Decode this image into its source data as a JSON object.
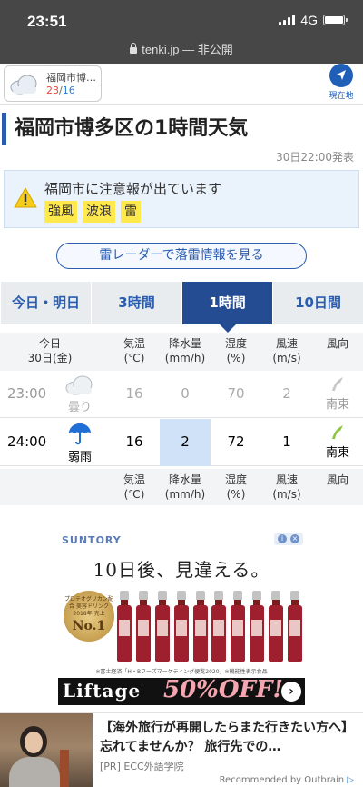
{
  "status_bar": {
    "time": "23:51",
    "network": "4G",
    "url": "tenki.jp — 非公開"
  },
  "header": {
    "location_name": "福岡市博…",
    "temp_high": "23",
    "temp_sep": "/",
    "temp_low": "16",
    "current_location_label": "現在地"
  },
  "page": {
    "title": "福岡市博多区の1時間天気",
    "issued": "30日22:00発表"
  },
  "alert": {
    "text": "福岡市に注意報が出ています",
    "tags": [
      "強風",
      "波浪",
      "雷"
    ]
  },
  "radar_button": "雷レーダーで落雷情報を見る",
  "tabs": [
    {
      "label": "今日・明日",
      "active": false
    },
    {
      "label": "3時間",
      "active": false
    },
    {
      "label": "1時間",
      "active": true
    },
    {
      "label": "10日間",
      "active": false
    }
  ],
  "table": {
    "date_line1": "今日",
    "date_line2": "30日(金)",
    "headers": [
      {
        "line1": "気温",
        "line2": "(℃)"
      },
      {
        "line1": "降水量",
        "line2": "(mm/h)"
      },
      {
        "line1": "湿度",
        "line2": "(%)"
      },
      {
        "line1": "風速",
        "line2": "(m/s)"
      },
      {
        "line1": "風向",
        "line2": ""
      }
    ],
    "rows": [
      {
        "time": "23:00",
        "weather": "曇り",
        "weather_icon": "cloud-icon",
        "temp": "16",
        "precip": "0",
        "humidity": "70",
        "wind_speed": "2",
        "wind_dir": "南東",
        "past": true
      },
      {
        "time": "24:00",
        "weather": "弱雨",
        "weather_icon": "umbrella-icon",
        "temp": "16",
        "precip": "2",
        "humidity": "72",
        "wind_speed": "1",
        "wind_dir": "南東",
        "past": false
      }
    ]
  },
  "ad": {
    "brand": "SUNTORY",
    "headline": "10日後、見違える。",
    "badge_text": "プロテオグリカン配合 美容ドリンク 2018年 売上",
    "badge_rank": "No.1",
    "fine_print": "※富士経済「H・Bフーズマーケティング便覧2020」※機能性表示食品",
    "product": "Liftage",
    "offer": "50%OFF!",
    "arrow": "›"
  },
  "outbrain": {
    "title": "【海外旅行が再開したらまた行きたい方へ】忘れてませんか？ 旅行先での…",
    "source": "[PR] ECC外語学院",
    "recommended": "Recommended by Outbrain"
  },
  "colors": {
    "brand_blue": "#244c93",
    "alert_yellow": "#ffe94d",
    "rain_highlight": "#cfe2f7",
    "temp_high": "#e04a3f",
    "temp_low": "#2a7ed6"
  }
}
